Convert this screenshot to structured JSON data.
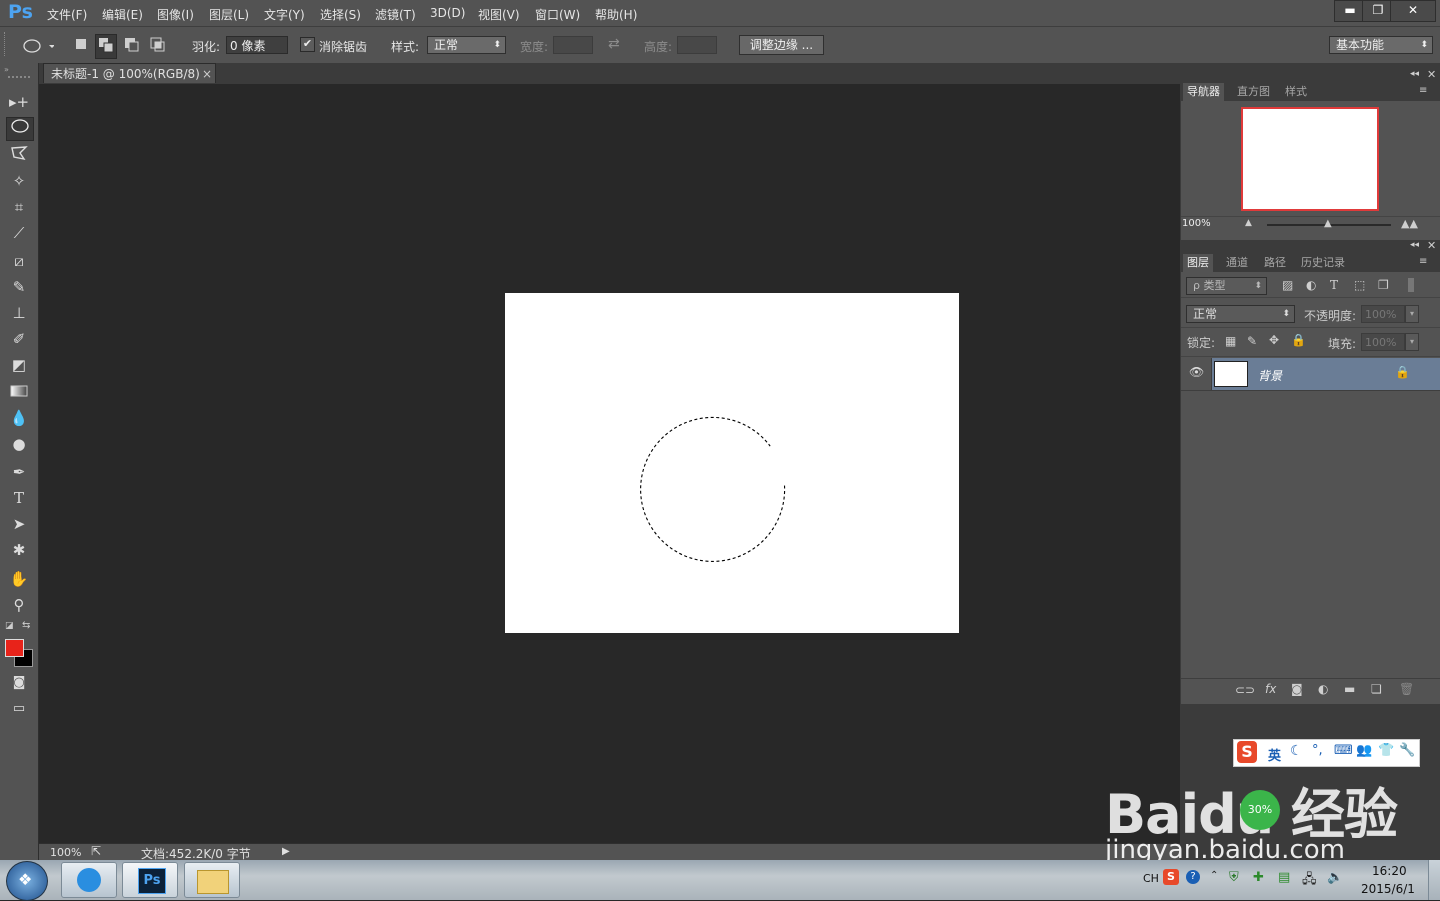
{
  "app": {
    "logo": "Ps"
  },
  "menu": [
    "文件(F)",
    "编辑(E)",
    "图像(I)",
    "图层(L)",
    "文字(Y)",
    "选择(S)",
    "滤镜(T)",
    "3D(D)",
    "视图(V)",
    "窗口(W)",
    "帮助(H)"
  ],
  "window_controls": {
    "minimize": "▬",
    "restore": "❐",
    "close": "✕"
  },
  "options": {
    "feather_label": "羽化:",
    "feather_value": "0 像素",
    "antialias_label": "消除锯齿",
    "antialias_checked": true,
    "style_label": "样式:",
    "style_value": "正常",
    "width_label": "宽度:",
    "height_label": "高度:",
    "refine_edge_button": "调整边缘 ...",
    "workspace_value": "基本功能"
  },
  "document": {
    "tab_title": "未标题-1 @ 100%(RGB/8)",
    "close": "×"
  },
  "statusbar": {
    "zoom": "100%",
    "doc_info": "文档:452.2K/0 字节"
  },
  "tools": [
    "move-tool",
    "elliptical-marquee-tool",
    "polygonal-lasso-tool",
    "magic-wand-tool",
    "crop-tool",
    "eyedropper-tool",
    "healing-brush-tool",
    "brush-tool",
    "clone-stamp-tool",
    "history-brush-tool",
    "eraser-tool",
    "gradient-tool",
    "blur-tool",
    "dodge-tool",
    "pen-tool",
    "type-tool",
    "path-selection-tool",
    "custom-shape-tool",
    "hand-tool",
    "zoom-tool"
  ],
  "colors": {
    "foreground": "#e8231a",
    "background": "#000000",
    "selection_marquee": "#000000",
    "navigator_frame": "#e03a3a",
    "layer_selected": "#6a7d96"
  },
  "navigator_panel": {
    "tabs": [
      "导航器",
      "直方图",
      "样式"
    ],
    "zoom": "100%"
  },
  "layers_panel": {
    "tabs": [
      "图层",
      "通道",
      "路径",
      "历史记录"
    ],
    "filter_label": "ρ 类型",
    "blend_mode": "正常",
    "opacity_label": "不透明度:",
    "opacity_value": "100%",
    "lock_label": "锁定:",
    "fill_label": "填充:",
    "fill_value": "100%",
    "layers": [
      {
        "name": "背景",
        "visible": true,
        "locked": true,
        "selected": true
      }
    ]
  },
  "ime": {
    "mode": "英"
  },
  "watermark": {
    "brand": "Baidu 经验",
    "url": "jingyan.baidu.com"
  },
  "taskbar": {
    "lang": "CH",
    "time": "16:20",
    "date": "2015/6/1",
    "tray_percent": "30%"
  }
}
